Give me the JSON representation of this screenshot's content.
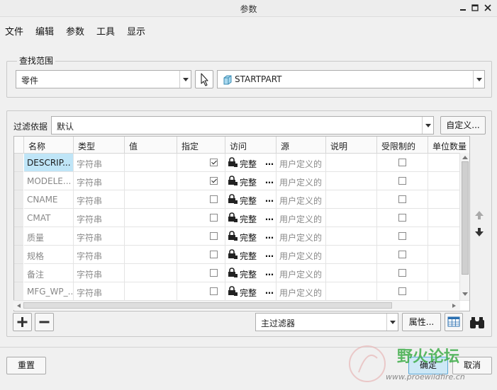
{
  "window": {
    "title": "参数"
  },
  "menu": [
    "文件",
    "编辑",
    "参数",
    "工具",
    "显示"
  ],
  "search_scope": {
    "legend": "查找范围",
    "type_value": "零件",
    "object_value": "STARTPART"
  },
  "filter": {
    "label": "过滤依据",
    "value": "默认",
    "customize_label": "自定义..."
  },
  "table": {
    "columns": [
      "名称",
      "类型",
      "值",
      "指定",
      "访问",
      "源",
      "说明",
      "受限制的",
      "单位数量"
    ],
    "rows": [
      {
        "name": "DESCRIP...",
        "type": "字符串",
        "value": "",
        "designated": true,
        "access": "完整",
        "source": "用户定义的",
        "restricted": false,
        "selected": true
      },
      {
        "name": "MODELE...",
        "type": "字符串",
        "value": "",
        "designated": true,
        "access": "完整",
        "source": "用户定义的",
        "restricted": false,
        "selected": false
      },
      {
        "name": "CNAME",
        "type": "字符串",
        "value": "",
        "designated": false,
        "access": "完整",
        "source": "用户定义的",
        "restricted": false,
        "selected": false
      },
      {
        "name": "CMAT",
        "type": "字符串",
        "value": "",
        "designated": false,
        "access": "完整",
        "source": "用户定义的",
        "restricted": false,
        "selected": false
      },
      {
        "name": "质量",
        "type": "字符串",
        "value": "",
        "designated": false,
        "access": "完整",
        "source": "用户定义的",
        "restricted": false,
        "selected": false
      },
      {
        "name": "规格",
        "type": "字符串",
        "value": "",
        "designated": false,
        "access": "完整",
        "source": "用户定义的",
        "restricted": false,
        "selected": false
      },
      {
        "name": "备注",
        "type": "字符串",
        "value": "",
        "designated": false,
        "access": "完整",
        "source": "用户定义的",
        "restricted": false,
        "selected": false
      },
      {
        "name": "MFG_WP_...",
        "type": "字符串",
        "value": "",
        "designated": false,
        "access": "完整",
        "source": "用户定义的",
        "restricted": false,
        "selected": false
      }
    ]
  },
  "bottom_bar": {
    "main_filter_value": "主过滤器",
    "properties_label": "属性..."
  },
  "footer": {
    "reset_label": "重置",
    "ok_label": "确定",
    "cancel_label": "取消"
  },
  "watermark": {
    "text": "野火论坛",
    "url": "www.proewildfire.cn"
  },
  "icons": [
    "minimize-icon",
    "maximize-icon",
    "close-icon",
    "pointer-select-icon",
    "part-icon",
    "lock-icon",
    "plus-icon",
    "minus-icon",
    "move-up-icon",
    "move-down-icon",
    "table-columns-icon",
    "binoculars-icon"
  ],
  "colors": {
    "selection": "#bfe5f7",
    "ok_button": "#cde8f6",
    "watermark": "#3fae4a"
  }
}
